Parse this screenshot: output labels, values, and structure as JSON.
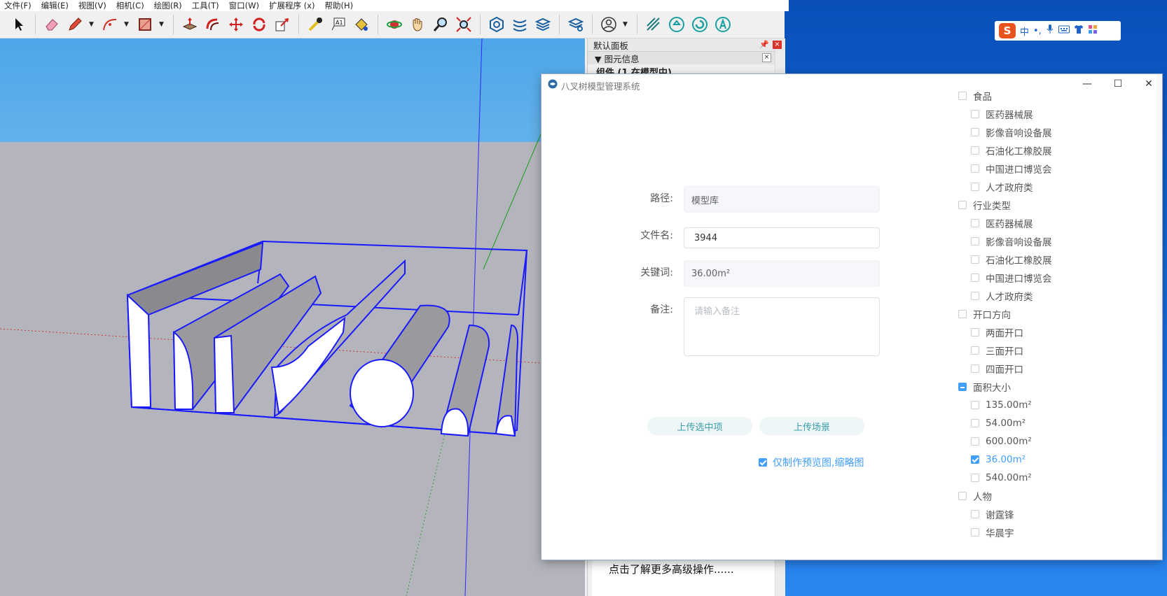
{
  "menubar": {
    "items": [
      "文件(F)",
      "编辑(E)",
      "视图(V)",
      "相机(C)",
      "绘图(R)",
      "工具(T)",
      "窗口(W)",
      "扩展程序 (x)",
      "帮助(H)"
    ]
  },
  "toolbar": {
    "icons": [
      "select-arrow-icon",
      "eraser-icon",
      "pencil-icon",
      "arc-icon",
      "rectangle-icon",
      "push-pull-icon",
      "offset-icon",
      "move-icon",
      "rotate-icon",
      "scale-icon",
      "tape-measure-icon",
      "text-label-icon",
      "paint-bucket-icon",
      "orbit-icon",
      "pan-hand-icon",
      "zoom-icon",
      "zoom-extents-icon",
      "warehouse-icon",
      "extension-icon",
      "layers-icon",
      "layers-settings-icon",
      "account-icon",
      "plugin-grid-icon",
      "plugin-upload-icon",
      "plugin-refresh-icon",
      "plugin-a-icon"
    ],
    "text_label_glyph": "A1"
  },
  "tray": {
    "title": "默认面板",
    "section": "▼ 图元信息",
    "component": "组件 (1 在模型中)",
    "tip": "点击了解更多高级操作......"
  },
  "ime": {
    "logo": "S",
    "mode": "中",
    "punct": "•,"
  },
  "dialog": {
    "title": "八叉树模型管理系统",
    "minimize": "—",
    "maximize": "☐",
    "close": "✕",
    "form": {
      "path_label": "路径:",
      "path_value": "模型库",
      "filename_label": "文件名:",
      "filename_value": "3944",
      "keyword_label": "关键词:",
      "keyword_value": "36.00m²",
      "note_label": "备注:",
      "note_placeholder": "请输入备注"
    },
    "buttons": {
      "upload_selected": "上传选中项",
      "upload_scene": "上传场景"
    },
    "preview_only_label": "仅制作预览图,缩略图",
    "tree": [
      {
        "label": "食品",
        "level": 0,
        "state": "unchecked"
      },
      {
        "label": "医药器械展",
        "level": 1,
        "state": "unchecked"
      },
      {
        "label": "影像音响设备展",
        "level": 1,
        "state": "unchecked"
      },
      {
        "label": "石油化工橡胶展",
        "level": 1,
        "state": "unchecked"
      },
      {
        "label": "中国进口博览会",
        "level": 1,
        "state": "unchecked"
      },
      {
        "label": "人才政府类",
        "level": 1,
        "state": "unchecked"
      },
      {
        "label": "行业类型",
        "level": 0,
        "state": "unchecked"
      },
      {
        "label": "医药器械展",
        "level": 1,
        "state": "unchecked"
      },
      {
        "label": "影像音响设备展",
        "level": 1,
        "state": "unchecked"
      },
      {
        "label": "石油化工橡胶展",
        "level": 1,
        "state": "unchecked"
      },
      {
        "label": "中国进口博览会",
        "level": 1,
        "state": "unchecked"
      },
      {
        "label": "人才政府类",
        "level": 1,
        "state": "unchecked"
      },
      {
        "label": "开口方向",
        "level": 0,
        "state": "unchecked"
      },
      {
        "label": "两面开口",
        "level": 1,
        "state": "unchecked"
      },
      {
        "label": "三面开口",
        "level": 1,
        "state": "unchecked"
      },
      {
        "label": "四面开口",
        "level": 1,
        "state": "unchecked"
      },
      {
        "label": "面积大小",
        "level": 0,
        "state": "partial"
      },
      {
        "label": "135.00m²",
        "level": 1,
        "state": "unchecked"
      },
      {
        "label": "54.00m²",
        "level": 1,
        "state": "unchecked"
      },
      {
        "label": "600.00m²",
        "level": 1,
        "state": "unchecked"
      },
      {
        "label": "36.00m²",
        "level": 1,
        "state": "checked"
      },
      {
        "label": "540.00m²",
        "level": 1,
        "state": "unchecked"
      },
      {
        "label": "人物",
        "level": 0,
        "state": "unchecked"
      },
      {
        "label": "谢霆锋",
        "level": 1,
        "state": "unchecked"
      },
      {
        "label": "华晨宇",
        "level": 1,
        "state": "unchecked"
      }
    ]
  },
  "colors": {
    "accent": "#409eff",
    "teal": "#3a9da8",
    "selection": "#1a1aff",
    "desktop": "#1366d6"
  }
}
